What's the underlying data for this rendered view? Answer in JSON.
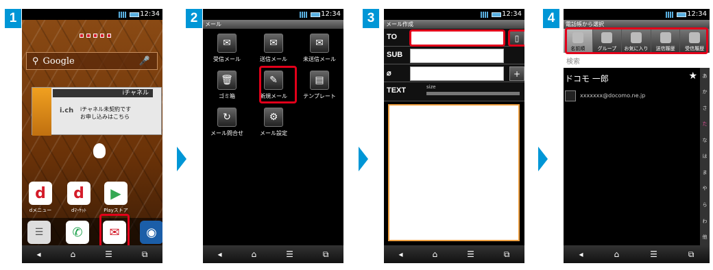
{
  "steps": [
    "1",
    "2",
    "3",
    "4"
  ],
  "status": {
    "time": "12:34"
  },
  "nav_icons": [
    "back-icon",
    "home-icon",
    "menu-icon",
    "recent-apps-icon"
  ],
  "nav_glyphs": [
    "◂",
    "⌂",
    "☰",
    "⧉"
  ],
  "accent": "#0096d6",
  "highlight": "#e2001a",
  "screen1": {
    "search_label": "Google",
    "widget_title": "iチャネル",
    "widget_line1": "iチャネル未契約です",
    "widget_line2": "お申し込みはこちら",
    "widget_logo": "i.ch",
    "apps": [
      {
        "label": "dメニュー",
        "glyph": "d"
      },
      {
        "label": "dﾏｰｹｯﾄ",
        "glyph": "d"
      },
      {
        "label": "Playストア",
        "glyph": "▶"
      }
    ],
    "dock": [
      "☰",
      "✆",
      "✉",
      "◉"
    ]
  },
  "screen2": {
    "title": "メール",
    "items": [
      {
        "label": "受信メール",
        "glyph": "✉"
      },
      {
        "label": "送信メール",
        "glyph": "✉"
      },
      {
        "label": "未送信メール",
        "glyph": "✉"
      },
      {
        "label": "ゴミ箱",
        "glyph": "🗑"
      },
      {
        "label": "新規メール",
        "glyph": "✎"
      },
      {
        "label": "テンプレート",
        "glyph": "▤"
      },
      {
        "label": "メール問合せ",
        "glyph": "↻"
      },
      {
        "label": "メール設定",
        "glyph": "⚙"
      }
    ]
  },
  "screen3": {
    "title": "メール作成",
    "to_label": "TO",
    "sub_label": "SUB",
    "text_label": "TEXT",
    "size_label": "size",
    "plus": "+",
    "book_glyph": "▯"
  },
  "screen4": {
    "title": "電話帳から選択",
    "tabs": [
      "名前順",
      "グループ",
      "お気に入り",
      "送信履歴",
      "受信履歴"
    ],
    "search": "検索",
    "contact_name": "ドコモ 一郎",
    "contact_email": "xxxxxxx@docomo.ne.jp",
    "star": "★",
    "index": [
      "あ",
      "か",
      "さ",
      "た",
      "な",
      "は",
      "ま",
      "や",
      "ら",
      "わ",
      "他"
    ]
  }
}
